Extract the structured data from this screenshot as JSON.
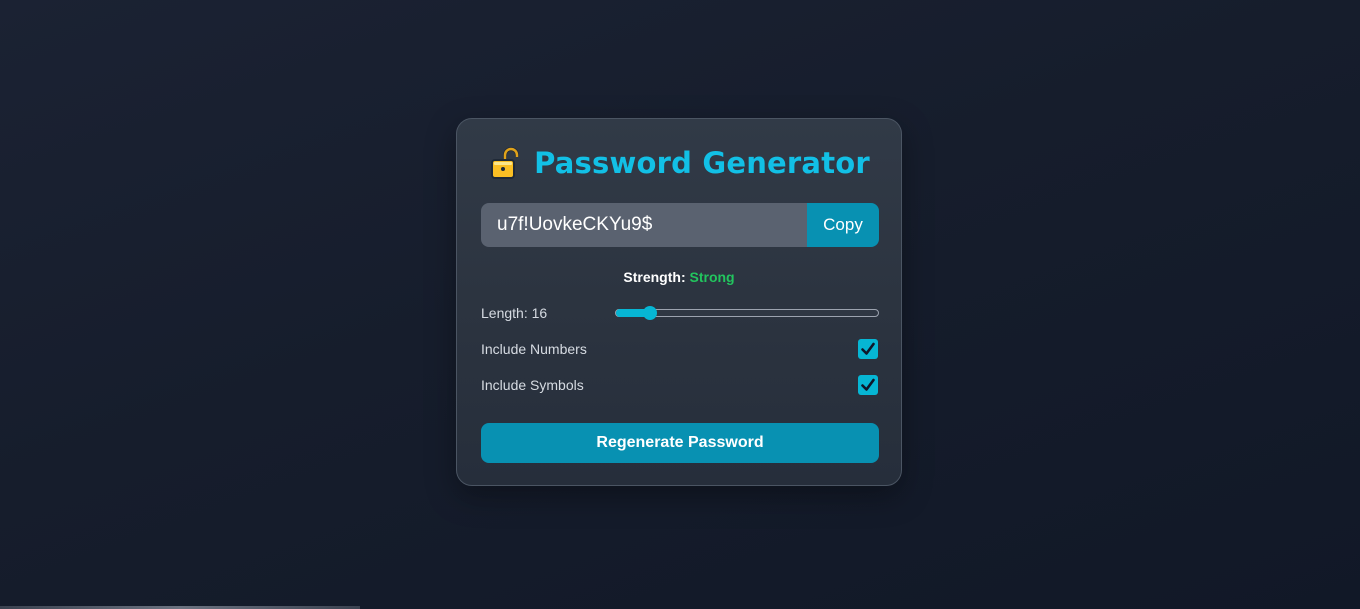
{
  "app": {
    "title": "Password Generator",
    "title_icon": "lock-icon"
  },
  "password": {
    "value": "u7f!UovkeCKYu9$",
    "copy_label": "Copy"
  },
  "strength": {
    "label": "Strength:",
    "value": "Strong",
    "color": "#22c55e"
  },
  "options": {
    "length_label": "Length: 16",
    "length_value": 16,
    "length_fraction": 0.13,
    "numbers_label": "Include Numbers",
    "numbers_checked": true,
    "symbols_label": "Include Symbols",
    "symbols_checked": true
  },
  "actions": {
    "regenerate_label": "Regenerate Password"
  },
  "colors": {
    "accent": "#06b6d4",
    "button": "#0891b2",
    "title": "#12c0e6"
  }
}
